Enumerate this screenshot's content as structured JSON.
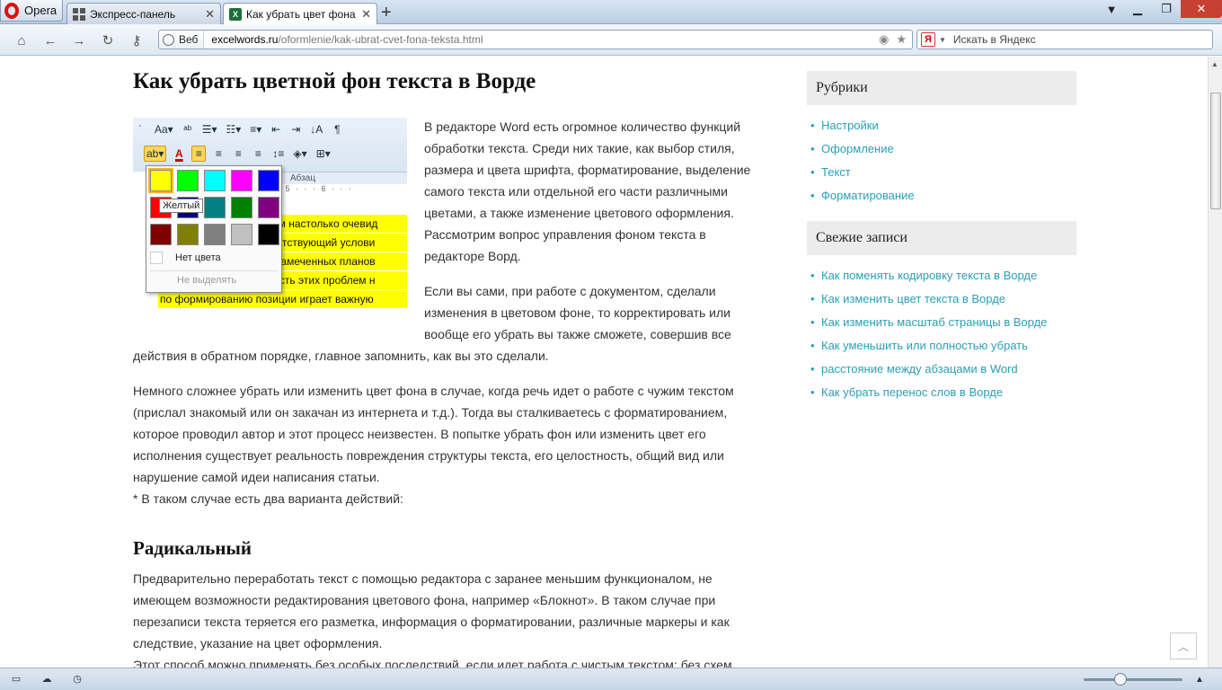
{
  "browser": {
    "menu_label": "Opera",
    "tabs": [
      {
        "label": "Экспресс-панель",
        "icon": "grid-icon"
      },
      {
        "label": "Как убрать цвет фона ...",
        "icon": "excel-icon",
        "icon_text": "X",
        "active": true
      }
    ],
    "new_tab_label": "+",
    "address": {
      "badge": "Веб",
      "host": "excelwords.ru",
      "path": "/oformlenie/kak-ubrat-cvet-fona-teksta.html"
    },
    "search": {
      "placeholder": "Искать в Яндекс",
      "engine_icon": "Я"
    }
  },
  "article": {
    "title": "Как убрать цветной фон текста в Ворде",
    "intro": "В редакторе Word есть огромное количество функций обработки текста. Среди них такие, как выбор стиля, размера и цвета шрифта, форматирование, выделение самого текста или отдельной его части различными цветами, а также изменение цветового оформления. Рассмотрим вопрос управления фоном текста в редакторе Ворд.",
    "para2_float": "Если вы сами, при работе с документом, сделали изменения в цветовом фоне, то корректировать или вообще его убрать вы также сможете, совершив все",
    "para2_rest": "действия в обратном порядке, главное запомнить, как вы это сделали.",
    "para3": "Немного сложнее убрать или изменить цвет фона в случае, когда речь идет о работе с чужим текстом (прислал знакомый или он закачан из интернета и т.д.). Тогда вы сталкиваетесь с форматированием, которое проводил автор и этот процесс неизвестен. В попытке убрать фон или изменить цвет его исполнения существует реальность повреждения структуры текста, его целостность, общий вид или нарушение самой идеи написания статьи.",
    "para3_note": "* В таком случае есть два варианта действий:",
    "h2": "Радикальный",
    "para4": "Предварительно переработать текст с помощью редактора с заранее меньшим функционалом, не имеющем возможности редактирования цветового фона, например «Блокнот». В таком случае при перезаписи текста теряется его разметка, информация о форматировании, различные маркеры и как следствие, указание на цвет оформления.",
    "para5": "Этот способ можно применять без особых последствий, если идет работа с чистым текстом: без схем"
  },
  "word_screenshot": {
    "ribbon_group_label": "Абзац",
    "ruler_ticks": "· 5 · · · 6 · · ·",
    "doc_lines": [
      "лем настолько очевид",
      "тветствующий услови",
      "я намеченных планов",
      "мость этих проблем н",
      "по формированию позиции играет важную"
    ],
    "tooltip": "Желтый",
    "palette_colors": [
      "#ffff00",
      "#00ff00",
      "#00ffff",
      "#ff00ff",
      "#0000ff",
      "#ff0000",
      "#000080",
      "#008080",
      "#008000",
      "#800080",
      "#800000",
      "#808000",
      "#808080",
      "#c0c0c0",
      "#000000"
    ],
    "no_color_label": "Нет цвета",
    "no_highlight_label": "Не выделять"
  },
  "sidebar": {
    "rubrics": {
      "title": "Рубрики",
      "items": [
        "Настройки",
        "Оформление",
        "Текст",
        "Форматирование"
      ]
    },
    "recent": {
      "title": "Свежие записи",
      "items": [
        "Как поменять кодировку текста в Ворде",
        "Как изменить цвет текста в Ворде",
        "Как изменить масштаб страницы в Ворде",
        "Как уменьшить или полностью убрать",
        "расстояние между абзацами в Word",
        "Как убрать перенос слов в Ворде"
      ]
    }
  },
  "colors": {
    "link": "#2a9fb6",
    "highlight": "#ffff00"
  }
}
